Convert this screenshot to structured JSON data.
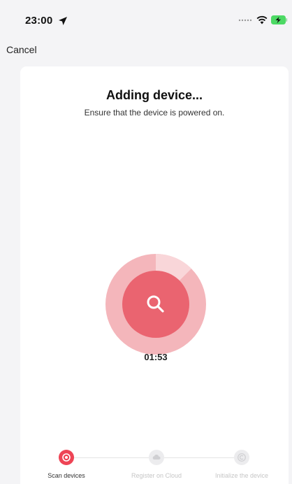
{
  "status_bar": {
    "time": "23:00",
    "icons": [
      "location-arrow-icon",
      "signal-dots-icon",
      "wifi-icon",
      "battery-charging-icon"
    ]
  },
  "nav": {
    "cancel_label": "Cancel"
  },
  "content": {
    "title": "Adding device...",
    "subtitle": "Ensure that the device is powered on.",
    "countdown": "01:53"
  },
  "steps": [
    {
      "label": "Scan devices",
      "icon": "scan-step-icon",
      "state": "active"
    },
    {
      "label": "Register on Cloud",
      "icon": "cloud-step-icon",
      "state": "pending"
    },
    {
      "label": "Initialize the device",
      "icon": "initialize-step-icon",
      "state": "pending"
    }
  ],
  "colors": {
    "accent": "#ee4455",
    "radar_outer": "#f4b6bb",
    "radar_inner": "#ea6470",
    "background": "#f4f4f6",
    "card": "#ffffff"
  }
}
